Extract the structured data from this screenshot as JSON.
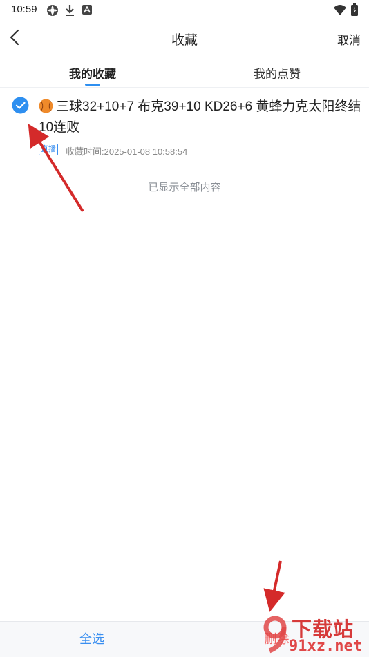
{
  "status_bar": {
    "time": "10:59"
  },
  "nav": {
    "title": "收藏",
    "cancel_label": "取消"
  },
  "tabs": [
    {
      "label": "我的收藏",
      "active": true
    },
    {
      "label": "我的点赞",
      "active": false
    }
  ],
  "items": [
    {
      "checked": true,
      "title": "三球32+10+7 布克39+10 KD26+6 黄蜂力克太阳终结10连败",
      "tag": "直播",
      "time": "收藏时间:2025-01-08 10:58:54"
    }
  ],
  "end_hint": "已显示全部内容",
  "bottom": {
    "select_all_label": "全选",
    "delete_label": "删除"
  },
  "watermark": {
    "text": "下载站",
    "url": "91xz.net"
  },
  "colors": {
    "accent": "#2e8ff0",
    "delete": "#f26565",
    "annotation_arrow": "#d42a2a"
  }
}
